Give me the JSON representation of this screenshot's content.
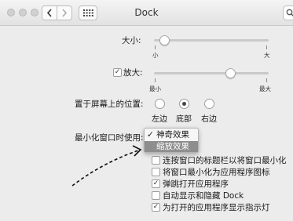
{
  "window": {
    "title": "Dock",
    "prefs_grid_icon": "grid-icon",
    "back_icon": "chevron-left-icon",
    "forward_icon": "chevron-right-icon",
    "search_icon": "search-icon"
  },
  "size": {
    "label": "大小:",
    "min_label": "小",
    "max_label": "大",
    "value_fraction": 0.11
  },
  "magnification": {
    "label": "放大:",
    "checked": true,
    "min_label": "最小",
    "max_label": "最大",
    "value_fraction": 0.68
  },
  "position": {
    "label": "置于屏幕上的位置:",
    "options": [
      "左边",
      "底部",
      "右边"
    ],
    "selected": "底部"
  },
  "minimize": {
    "label": "最小化窗口时使用:",
    "menu": {
      "items": [
        "神奇效果",
        "缩放效果"
      ],
      "checked": "神奇效果",
      "highlighted": "缩放效果"
    }
  },
  "checkboxes": [
    {
      "label": "连按窗口的标题栏以将窗口最小化",
      "checked": false
    },
    {
      "label": "将窗口最小化为应用程序图标",
      "checked": false
    },
    {
      "label": "弹跳打开应用程序",
      "checked": true
    },
    {
      "label": "自动显示和隐藏 Dock",
      "checked": false
    },
    {
      "label": "为打开的应用程序显示指示灯",
      "checked": true
    }
  ],
  "annotation": {
    "type": "dashed-arrow",
    "color": "#111111"
  }
}
